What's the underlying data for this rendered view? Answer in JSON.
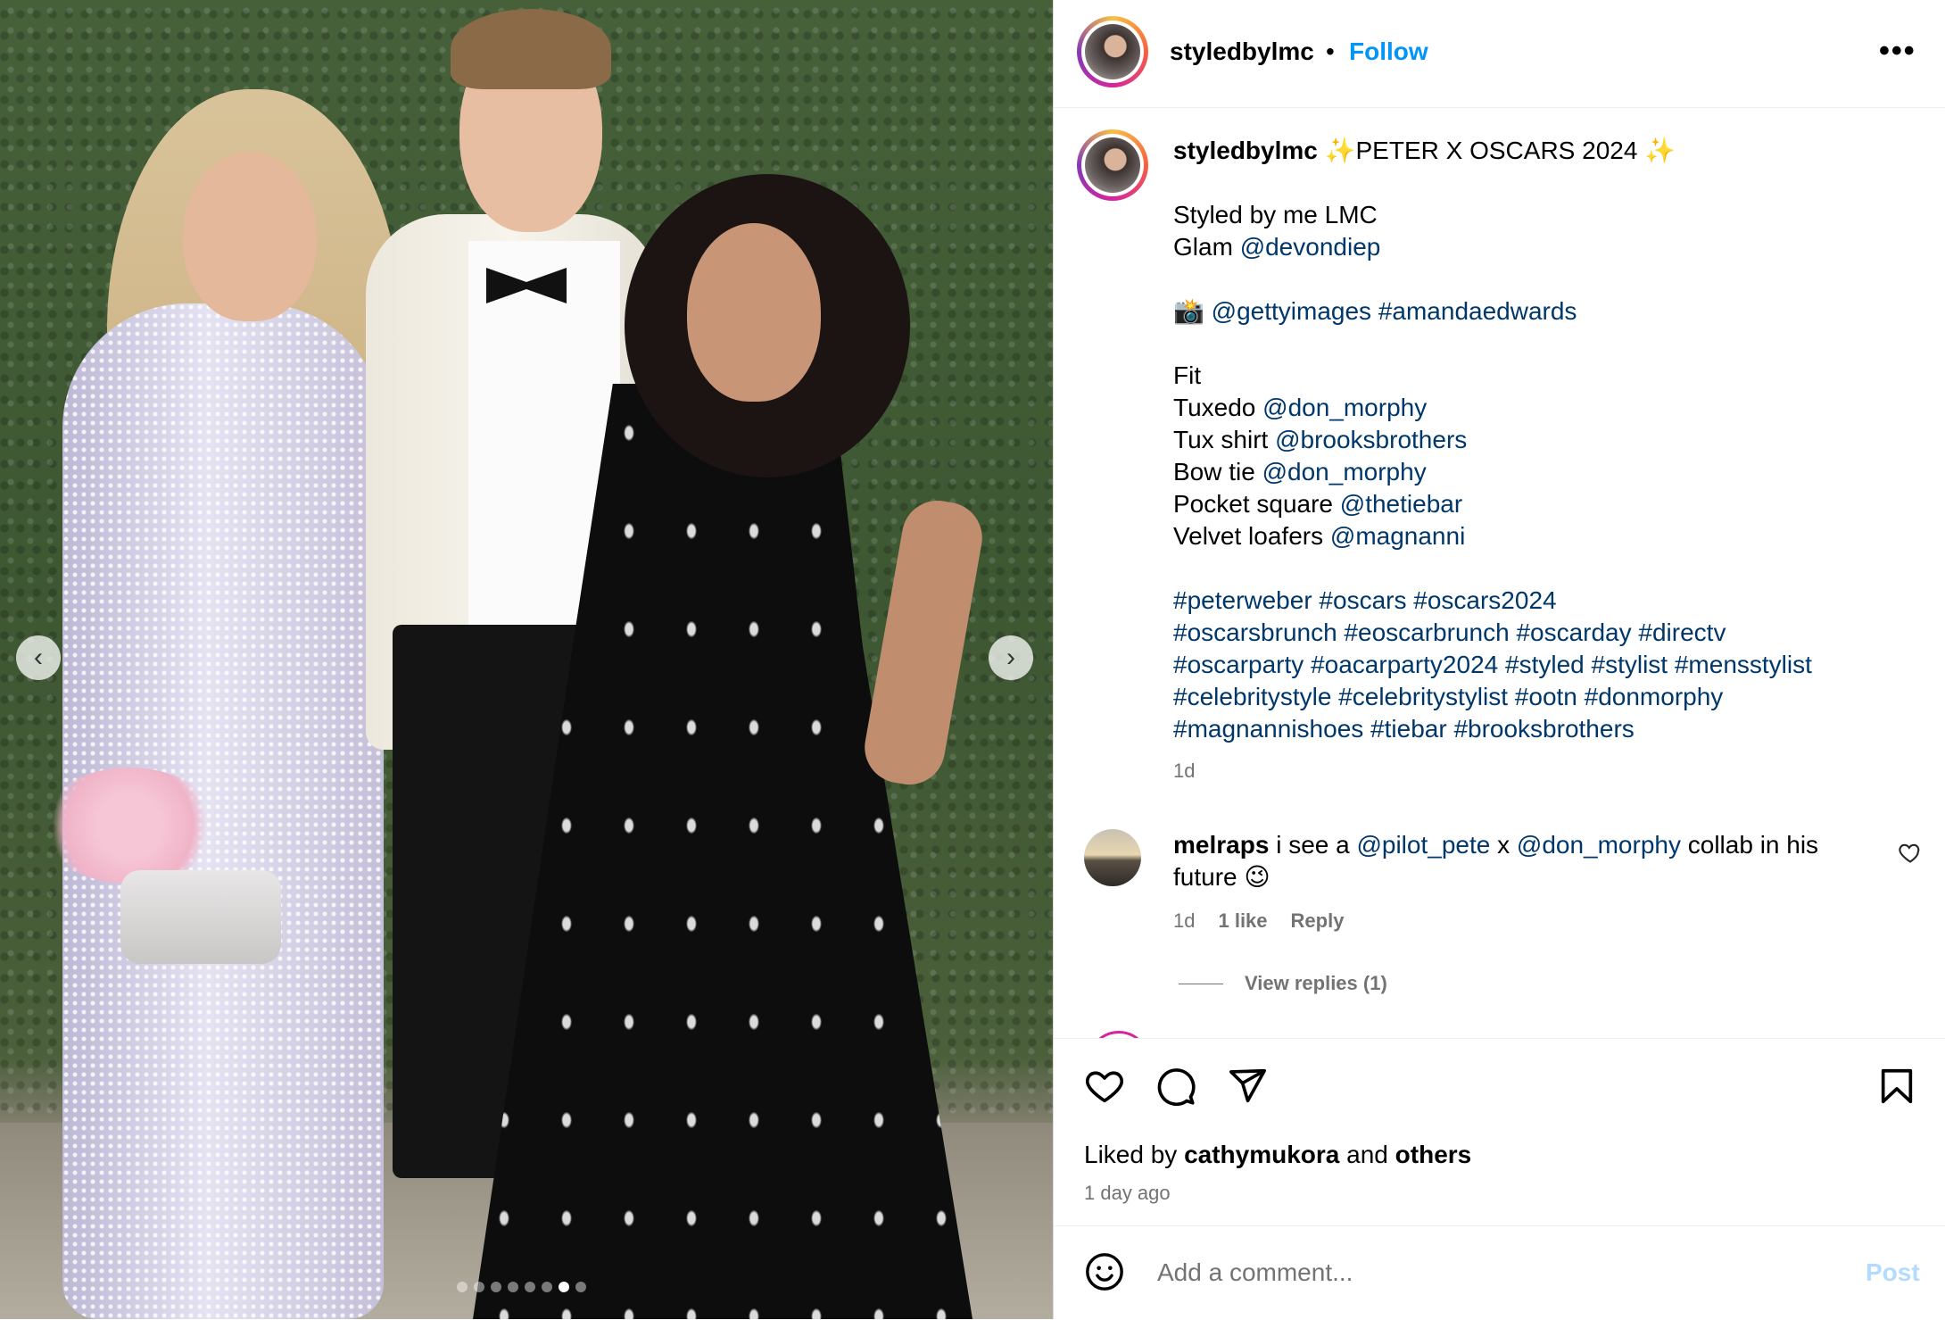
{
  "post": {
    "username": "styledbylmc",
    "separator": "•",
    "follow_label": "Follow",
    "more_label": "•••",
    "carousel": {
      "slide_count": 8,
      "active_slide": 7,
      "prev_label": "‹",
      "next_label": "›"
    }
  },
  "caption": {
    "username": "styledbylmc",
    "title": "✨PETER X OSCARS 2024 ✨",
    "line_styled": "Styled by me LMC",
    "glam_label": "Glam",
    "glam_tag": "@devondiep",
    "photo_emoji": "📸",
    "photo_tag1": "@gettyimages",
    "photo_tag2": "#amandaedwards",
    "fit_label": "Fit",
    "fit": [
      {
        "label": "Tuxedo",
        "tag": "@don_morphy"
      },
      {
        "label": "Tux shirt",
        "tag": "@brooksbrothers"
      },
      {
        "label": "Bow tie",
        "tag": "@don_morphy"
      },
      {
        "label": "Pocket square",
        "tag": "@thetiebar"
      },
      {
        "label": "Velvet loafers",
        "tag": "@magnanni"
      }
    ],
    "hashtag_lines": [
      "#peterweber #oscars #oscars2024",
      "#oscarsbrunch #eoscarbrunch #oscarday #directv",
      "#oscarparty #oacarparty2024 #styled #stylist #mensstylist",
      "#celebritystyle #celebritystylist #ootn #donmorphy",
      "#magnannishoes #tiebar #brooksbrothers"
    ],
    "time": "1d"
  },
  "comment": {
    "username": "melraps",
    "text_before": "i see a",
    "tag1": "@pilot_pete",
    "text_mid": "x",
    "tag2": "@don_morphy",
    "text_after": "collab in his future 😉",
    "time": "1d",
    "likes": "1 like",
    "reply_label": "Reply",
    "view_replies": "View replies (1)"
  },
  "engagement": {
    "liked_by_prefix": "Liked by",
    "liked_by_user": "cathymukora",
    "liked_by_and": "and",
    "liked_by_others": "others",
    "time_ago": "1 day ago"
  },
  "comment_box": {
    "placeholder": "Add a comment...",
    "post_label": "Post"
  },
  "icons": {
    "like": "heart-icon",
    "comment": "comment-bubble-icon",
    "share": "paper-plane-icon",
    "save": "bookmark-icon",
    "emoji": "smiley-icon"
  },
  "colors": {
    "follow": "#0095f6",
    "tag": "#00376b",
    "muted": "#737373",
    "post_disabled": "#b3dbff"
  }
}
